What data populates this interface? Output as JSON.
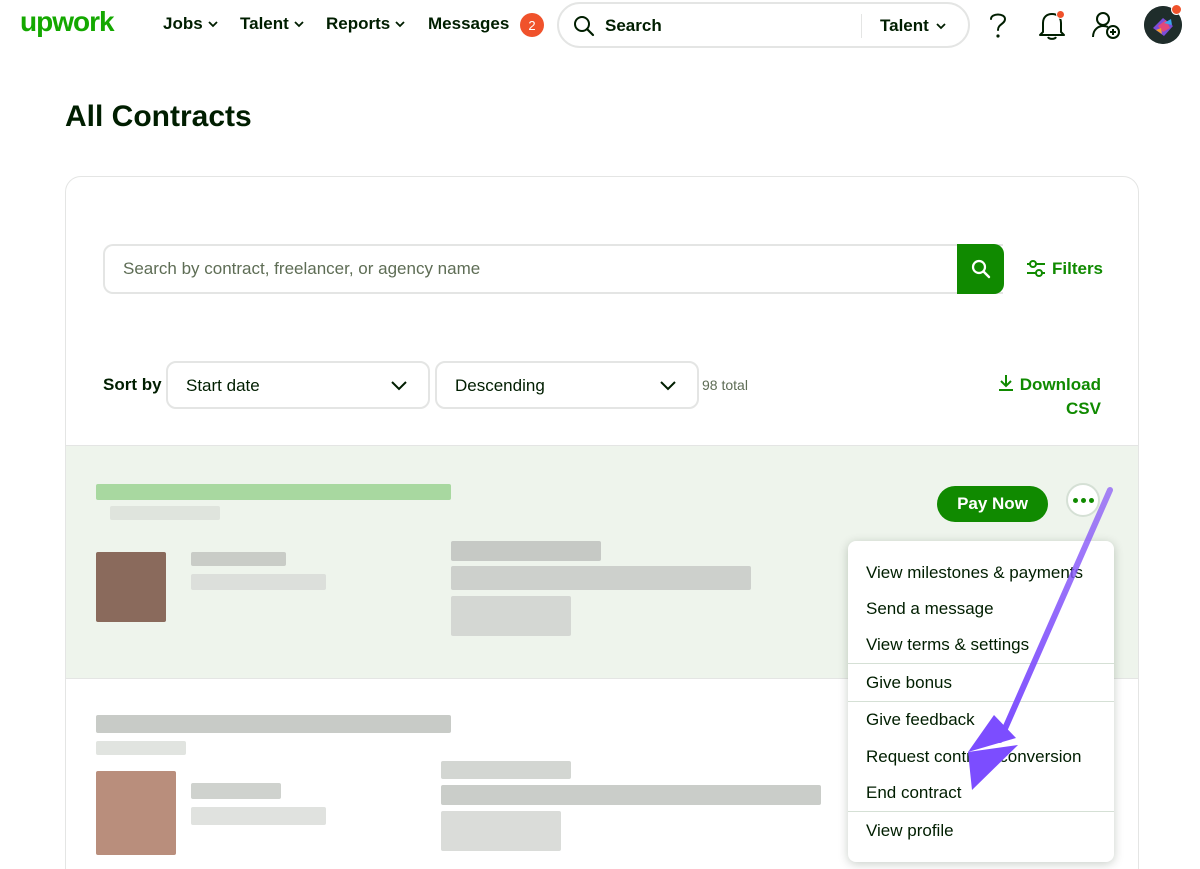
{
  "nav": {
    "logo": "upwork",
    "items": [
      {
        "label": "Jobs"
      },
      {
        "label": "Talent"
      },
      {
        "label": "Reports"
      }
    ],
    "messages_label": "Messages",
    "messages_count": "2",
    "search_label": "Search",
    "search_scope": "Talent"
  },
  "page": {
    "title": "All Contracts"
  },
  "contracts": {
    "search_placeholder": "Search by contract, freelancer, or agency name",
    "filters_label": "Filters",
    "sort_label": "Sort by",
    "sort_field": "Start date",
    "sort_order": "Descending",
    "total": "98 total",
    "download_line1": "Download",
    "download_line2": "CSV",
    "pay_now": "Pay Now"
  },
  "menu": {
    "items": [
      "View milestones & payments",
      "Send a message",
      "View terms & settings",
      "Give bonus",
      "Give feedback",
      "Request contract conversion",
      "End contract",
      "View profile"
    ]
  },
  "colors": {
    "brand_green": "#14a800",
    "button_green": "#108a00",
    "badge_red": "#f0522b",
    "annotation_purple": "#8b5cf6",
    "row_highlight": "#eef4ec"
  }
}
